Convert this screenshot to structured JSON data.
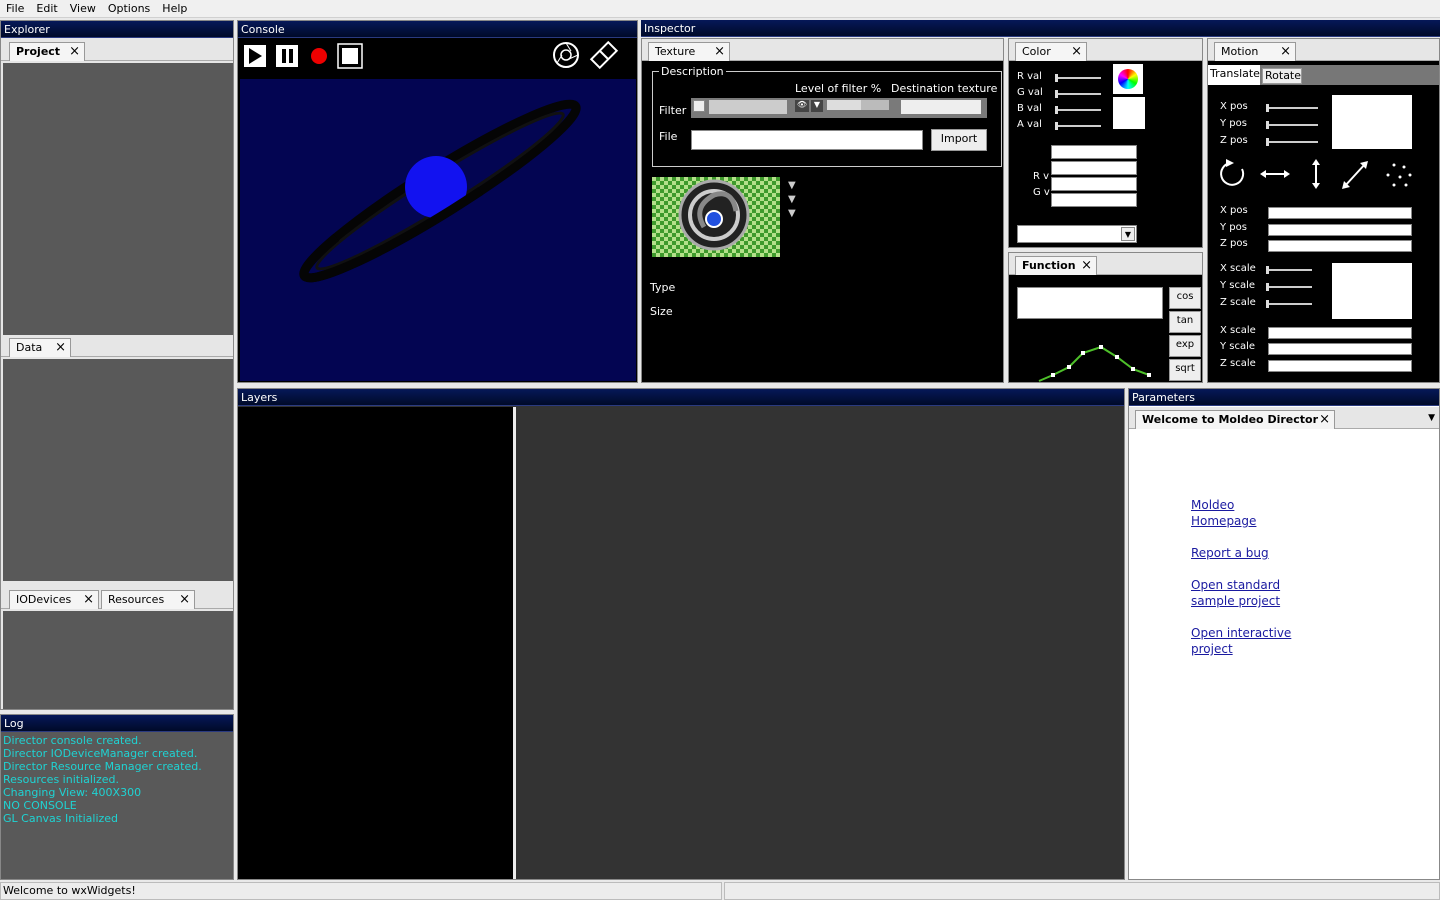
{
  "menu": [
    "File",
    "Edit",
    "View",
    "Options",
    "Help"
  ],
  "explorer": {
    "title": "Explorer",
    "project_tab": "Project",
    "data_tab": "Data",
    "iodevices_tab": "IODevices",
    "resources_tab": "Resources"
  },
  "log": {
    "title": "Log",
    "lines": [
      "Director console created.",
      "Director IODeviceManager created.",
      "Director Resource Manager created.",
      "Resources initialized.",
      "Changing View: 400X300",
      "NO CONSOLE",
      "GL Canvas Initialized"
    ]
  },
  "console": {
    "title": "Console"
  },
  "inspector": {
    "title": "Inspector",
    "texture_tab": "Texture",
    "description": "Description",
    "level_label": "Level of filter %",
    "dest_label": "Destination texture",
    "filter_label": "Filter",
    "file_label": "File",
    "import_button": "Import",
    "type_label": "Type",
    "size_label": "Size"
  },
  "color": {
    "tab": "Color",
    "r": "R val",
    "g": "G val",
    "b": "B val",
    "a": "A val",
    "rv": "R v",
    "gv": "G v"
  },
  "function": {
    "tab": "Function",
    "buttons": [
      "cos",
      "tan",
      "exp",
      "sqrt"
    ]
  },
  "motion": {
    "tab": "Motion",
    "translate_tab": "Translate",
    "rotate_tab": "Rotate",
    "xpos": "X pos",
    "ypos": "Y pos",
    "zpos": "Z pos",
    "xscale": "X scale",
    "yscale": "Y scale",
    "zscale": "Z scale"
  },
  "layers": {
    "title": "Layers"
  },
  "parameters": {
    "title": "Parameters",
    "welcome_tab": "Welcome to Moldeo Director",
    "links": [
      [
        "Moldeo",
        "Homepage"
      ],
      [
        "Report a bug"
      ],
      [
        "Open standard",
        "sample project"
      ],
      [
        "Open interactive",
        "project"
      ]
    ]
  },
  "statusbar": {
    "text": "Welcome to wxWidgets!"
  }
}
